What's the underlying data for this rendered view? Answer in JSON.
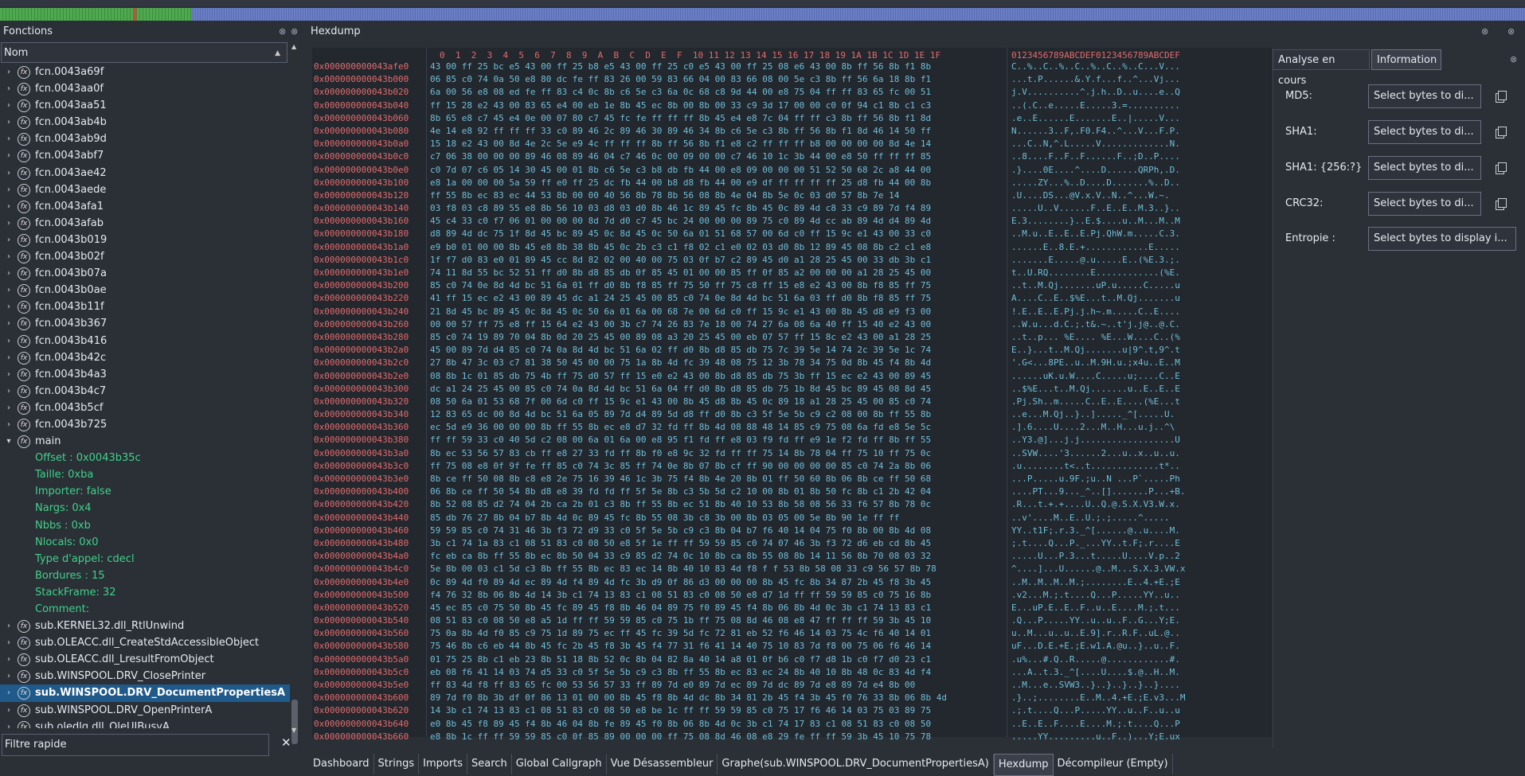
{
  "left_panel": {
    "title": "Fonctions",
    "column_header": "Nom",
    "filter_placeholder": "Filtre rapide",
    "filter_clear": "✕",
    "items": [
      {
        "label": "fcn.0043a69f",
        "kind": "fn"
      },
      {
        "label": "fcn.0043aa0f",
        "kind": "fn"
      },
      {
        "label": "fcn.0043aa51",
        "kind": "fn"
      },
      {
        "label": "fcn.0043ab4b",
        "kind": "fn"
      },
      {
        "label": "fcn.0043ab9d",
        "kind": "fn"
      },
      {
        "label": "fcn.0043abf7",
        "kind": "fn"
      },
      {
        "label": "fcn.0043ae42",
        "kind": "fn"
      },
      {
        "label": "fcn.0043aede",
        "kind": "fn"
      },
      {
        "label": "fcn.0043afa1",
        "kind": "fn"
      },
      {
        "label": "fcn.0043afab",
        "kind": "fn"
      },
      {
        "label": "fcn.0043b019",
        "kind": "fn"
      },
      {
        "label": "fcn.0043b02f",
        "kind": "fn"
      },
      {
        "label": "fcn.0043b07a",
        "kind": "fn"
      },
      {
        "label": "fcn.0043b0ae",
        "kind": "fn"
      },
      {
        "label": "fcn.0043b11f",
        "kind": "fn"
      },
      {
        "label": "fcn.0043b367",
        "kind": "fn"
      },
      {
        "label": "fcn.0043b416",
        "kind": "fn"
      },
      {
        "label": "fcn.0043b42c",
        "kind": "fn"
      },
      {
        "label": "fcn.0043b4a3",
        "kind": "fn"
      },
      {
        "label": "fcn.0043b4c7",
        "kind": "fn"
      },
      {
        "label": "fcn.0043b5cf",
        "kind": "fn"
      },
      {
        "label": "fcn.0043b725",
        "kind": "fn"
      },
      {
        "label": "main",
        "kind": "fn-open"
      },
      {
        "label": "Offset : 0x0043b35c",
        "kind": "prop"
      },
      {
        "label": "Taille: 0xba",
        "kind": "prop"
      },
      {
        "label": "Importer: false",
        "kind": "prop"
      },
      {
        "label": "Nargs: 0x4",
        "kind": "prop"
      },
      {
        "label": "Nbbs : 0xb",
        "kind": "prop"
      },
      {
        "label": "Nlocals: 0x0",
        "kind": "prop"
      },
      {
        "label": "Type d'appel: cdecl",
        "kind": "prop"
      },
      {
        "label": "Bordures : 15",
        "kind": "prop"
      },
      {
        "label": "StackFrame: 32",
        "kind": "prop"
      },
      {
        "label": "Comment:",
        "kind": "prop"
      },
      {
        "label": "sub.KERNEL32.dll_RtlUnwind",
        "kind": "fn"
      },
      {
        "label": "sub.OLEACC.dll_CreateStdAccessibleObject",
        "kind": "fn"
      },
      {
        "label": "sub.OLEACC.dll_LresultFromObject",
        "kind": "fn"
      },
      {
        "label": "sub.WINSPOOL.DRV_ClosePrinter",
        "kind": "fn"
      },
      {
        "label": "sub.WINSPOOL.DRV_DocumentPropertiesA",
        "kind": "fn-selected"
      },
      {
        "label": "sub.WINSPOOL.DRV_OpenPrinterA",
        "kind": "fn"
      },
      {
        "label": "sub.oledlg.dll_OleUIBusyA",
        "kind": "fn"
      }
    ]
  },
  "hexdump": {
    "title": "Hexdump",
    "header_bytes": "0  1  2  3  4  5  6  7  8  9  A  B  C  D  E  F  10 11 12 13 14 15 16 17 18 19 1A 1B 1C 1D 1E 1F",
    "header_ascii": "0123456789ABCDEF0123456789ABCDEF",
    "rows": [
      {
        "addr": "0x000000000043afe0",
        "bytes": "43 00 ff 25 bc e5 43 00 ff 25 b8 e5 43 00 ff 25 c0 e5 43 00 ff 25 08 e6 43 00 8b ff 56 8b f1 8b",
        "ascii": "C..%..C..%..C..%..C..%..C...V..."
      },
      {
        "addr": "0x000000000043b000",
        "bytes": "06 85 c0 74 0a 50 e8 80 dc fe ff 83 26 00 59 83 66 04 00 83 66 08 00 5e c3 8b ff 56 6a 18 8b f1",
        "ascii": "...t.P......&.Y.f...f..^...Vj..."
      },
      {
        "addr": "0x000000000043b020",
        "bytes": "6a 00 56 e8 08 ed fe ff 83 c4 0c 8b c6 5e c3 6a 0c 68 c8 9d 44 00 e8 75 04 ff ff 83 65 fc 00 51",
        "ascii": "j.V..........^.j.h..D..u....e..Q"
      },
      {
        "addr": "0x000000000043b040",
        "bytes": "ff 15 28 e2 43 00 83 65 e4 00 eb 1e 8b 45 ec 8b 00 8b 00 33 c9 3d 17 00 00 c0 0f 94 c1 8b c1 c3",
        "ascii": "..(.C..e.....E.....3.=.........."
      },
      {
        "addr": "0x000000000043b060",
        "bytes": "8b 65 e8 c7 45 e4 0e 00 07 80 c7 45 fc fe ff ff ff 8b 45 e4 e8 7c 04 ff ff c3 8b ff 56 8b f1 8d",
        "ascii": ".e..E......E.......E..|.....V..."
      },
      {
        "addr": "0x000000000043b080",
        "bytes": "4e 14 e8 92 ff ff ff 33 c0 89 46 2c 89 46 30 89 46 34 8b c6 5e c3 8b ff 56 8b f1 8d 46 14 50 ff",
        "ascii": "N......3..F,.F0.F4..^...V...F.P."
      },
      {
        "addr": "0x000000000043b0a0",
        "bytes": "15 18 e2 43 00 8d 4e 2c 5e e9 4c ff ff ff 8b ff 56 8b f1 e8 c2 ff ff ff b8 00 00 00 00 8d 4e 14",
        "ascii": "...C..N,^.L.....V.............N."
      },
      {
        "addr": "0x000000000043b0c0",
        "bytes": "c7 06 38 00 00 00 89 46 08 89 46 04 c7 46 0c 00 09 00 00 c7 46 10 1c 3b 44 00 e8 50 ff ff ff 85",
        "ascii": "..8....F..F..F......F..;D..P...."
      },
      {
        "addr": "0x000000000043b0e0",
        "bytes": "c0 7d 07 c6 05 14 30 45 00 01 8b c6 5e c3 b8 db fb 44 00 e8 09 00 00 00 51 52 50 68 2c a8 44 00",
        "ascii": ".}....0E....^....D......QRPh,.D."
      },
      {
        "addr": "0x000000000043b100",
        "bytes": "e8 1a 00 00 00 5a 59 ff e0 ff 25 dc fb 44 00 b8 d8 fb 44 00 e9 df ff ff ff ff 25 d8 fb 44 00 8b",
        "ascii": ".....ZY...%..D....D.......%..D.."
      },
      {
        "addr": "0x000000000043b120",
        "bytes": "ff 55 8b ec 83 ec 44 53 8b 00 00 40 56 8b 78 8b 56 08 8b 4e 04 8b 5e 0c 03 d0 57 8b 7e 14",
        "ascii": ".U....DS...@V.x.V..N..^...W.~."
      },
      {
        "addr": "0x000000000043b140",
        "bytes": "03 f8 03 c8 89 55 e8 8b 56 10 03 d8 03 d0 8b 46 1c 89 45 fc 8b 45 0c 89 4d c8 33 c9 89 7d f4 89",
        "ascii": ".....U..V......F..E..E..M.3..}.."
      },
      {
        "addr": "0x000000000043b160",
        "bytes": "45 c4 33 c0 f7 06 01 00 00 00 8d 7d d0 c7 45 bc 24 00 00 00 89 75 c0 89 4d cc ab 89 4d d4 89 4d",
        "ascii": "E.3........}..E.$....u..M...M..M"
      },
      {
        "addr": "0x000000000043b180",
        "bytes": "d8 89 4d dc 75 1f 8d 45 bc 89 45 0c 8d 45 0c 50 6a 01 51 68 57 00 6d c0 ff 15 9c e1 43 00 33 c0",
        "ascii": "..M.u..E..E..E.Pj.QhW.m.....C.3."
      },
      {
        "addr": "0x000000000043b1a0",
        "bytes": "e9 b0 01 00 00 8b 45 e8 8b 38 8b 45 0c 2b c3 c1 f8 02 c1 e0 02 03 d0 8b 12 89 45 08 8b c2 c1 e8",
        "ascii": "......E..8.E.+............E....."
      },
      {
        "addr": "0x000000000043b1c0",
        "bytes": "1f f7 d0 83 e0 01 89 45 cc 8d 82 02 00 40 00 75 03 0f b7 c2 89 45 d0 a1 28 25 45 00 33 db 3b c1",
        "ascii": ".......E.....@.u.....E..(%E.3.;."
      },
      {
        "addr": "0x000000000043b1e0",
        "bytes": "74 11 8d 55 bc 52 51 ff d0 8b d8 85 db 0f 85 45 01 00 00 85 ff 0f 85 a2 00 00 00 a1 28 25 45 00",
        "ascii": "t..U.RQ........E............(%E."
      },
      {
        "addr": "0x000000000043b200",
        "bytes": "85 c0 74 0e 8d 4d bc 51 6a 01 ff d0 8b f8 85 ff 75 50 ff 75 c8 ff 15 e8 e2 43 00 8b f8 85 ff 75",
        "ascii": "..t..M.Qj.......uP.u.....C.....u"
      },
      {
        "addr": "0x000000000043b220",
        "bytes": "41 ff 15 ec e2 43 00 89 45 dc a1 24 25 45 00 85 c0 74 0e 8d 4d bc 51 6a 03 ff d0 8b f8 85 ff 75",
        "ascii": "A....C..E..$%E...t..M.Qj.......u"
      },
      {
        "addr": "0x000000000043b240",
        "bytes": "21 8d 45 bc 89 45 0c 8d 45 0c 50 6a 01 6a 00 68 7e 00 6d c0 ff 15 9c e1 43 00 8b 45 d8 e9 f3 00",
        "ascii": "!.E..E..E.Pj.j.h~.m.....C..E...."
      },
      {
        "addr": "0x000000000043b260",
        "bytes": "00 00 57 ff 75 e8 ff 15 64 e2 43 00 3b c7 74 26 83 7e 18 00 74 27 6a 08 6a 40 ff 15 40 e2 43 00",
        "ascii": "..W.u...d.C.;.t&.~..t'j.j@..@.C."
      },
      {
        "addr": "0x000000000043b280",
        "bytes": "85 c0 74 19 89 70 04 8b 0d 20 25 45 00 89 08 a3 20 25 45 00 eb 07 57 ff 15 8c e2 43 00 a1 28 25",
        "ascii": "..t..p... %E.... %E...W....C..(%"
      },
      {
        "addr": "0x000000000043b2a0",
        "bytes": "45 00 89 7d d4 85 c0 74 0a 8d 4d bc 51 6a 02 ff d0 8b d8 85 db 75 7c 39 5e 14 74 2c 39 5e 1c 74",
        "ascii": "E..}...t..M.Qj.......u|9^.t,9^.t"
      },
      {
        "addr": "0x000000000043b2c0",
        "bytes": "27 8b 47 3c 03 c7 81 38 50 45 00 00 75 1a 8b 4d fc 39 48 08 75 12 3b 78 34 75 0d 8b 45 f4 8b 4d",
        "ascii": "'.G<...8PE..u..M.9H.u.;x4u..E..M"
      },
      {
        "addr": "0x000000000043b2e0",
        "bytes": "08 8b 1c 01 85 db 75 4b ff 75 d0 57 ff 15 e0 e2 43 00 8b d8 85 db 75 3b ff 15 ec e2 43 00 89 45",
        "ascii": "......uK.u.W....C.....u;....C..E"
      },
      {
        "addr": "0x000000000043b300",
        "bytes": "dc a1 24 25 45 00 85 c0 74 0a 8d 4d bc 51 6a 04 ff d0 8b d8 85 db 75 1b 8d 45 bc 89 45 08 8d 45",
        "ascii": "..$%E...t..M.Qj.......u..E..E..E"
      },
      {
        "addr": "0x000000000043b320",
        "bytes": "08 50 6a 01 53 68 7f 00 6d c0 ff 15 9c e1 43 00 8b 45 d8 8b 45 0c 89 18 a1 28 25 45 00 85 c0 74",
        "ascii": ".Pj.Sh..m.....C..E..E....(%E...t"
      },
      {
        "addr": "0x000000000043b340",
        "bytes": "12 83 65 dc 00 8d 4d bc 51 6a 05 89 7d d4 89 5d d8 ff d0 8b c3 5f 5e 5b c9 c2 08 00 8b ff 55 8b",
        "ascii": "..e...M.Qj..}..]....._^[.....U."
      },
      {
        "addr": "0x000000000043b360",
        "bytes": "ec 5d e9 36 00 00 00 8b ff 55 8b ec e8 d7 32 fd ff 8b 4d 08 88 48 14 85 c9 75 08 6a fd e8 5e 5c",
        "ascii": ".].6....U....2...M..H...u.j..^\\"
      },
      {
        "addr": "0x000000000043b380",
        "bytes": "ff ff 59 33 c0 40 5d c2 08 00 6a 01 6a 00 e8 95 f1 fd ff e8 03 f9 fd ff e9 1e f2 fd ff 8b ff 55",
        "ascii": "..Y3.@]...j.j..................U"
      },
      {
        "addr": "0x000000000043b3a0",
        "bytes": "8b ec 53 56 57 83 cb ff e8 27 33 fd ff 8b f0 e8 9c 32 fd ff ff 75 14 8b 78 04 ff 75 10 ff 75 0c",
        "ascii": "..SVW....'3......2...u..x..u..u."
      },
      {
        "addr": "0x000000000043b3c0",
        "bytes": "ff 75 08 e8 0f 9f fe ff 85 c0 74 3c 85 ff 74 0e 8b 07 8b cf ff 90 00 00 00 00 85 c0 74 2a 8b 06",
        "ascii": ".u........t<..t.............t*.."
      },
      {
        "addr": "0x000000000043b3e0",
        "bytes": "8b ce ff 50 08 8b c8 e8 2e 75 16 39 46 1c 3b 75 f4 8b 4e 20 8b 01 ff 50 60 8b 06 8b ce ff 50 68",
        "ascii": "...P.....u.9F.;u..N ...P`.....Ph"
      },
      {
        "addr": "0x000000000043b400",
        "bytes": "06 8b ce ff 50 54 8b d8 e8 39 fd fd ff 5f 5e 8b c3 5b 5d c2 10 00 8b 01 8b 50 fc 8b c1 2b 42 04",
        "ascii": "....PT...9..._^..[].......P...+B."
      },
      {
        "addr": "0x000000000043b420",
        "bytes": "8b 52 08 85 d2 74 04 2b ca 2b 01 c3 8b ff 55 8b ec 51 8b 40 10 53 8b 58 08 56 33 f6 57 8b 78 0c",
        "ascii": ".R...t.+.+....U..Q.@.S.X.V3.W.x."
      },
      {
        "addr": "0x000000000043b440",
        "bytes": "85 db 76 27 8b 04 b7 8b 4d 0c 89 45 fc 8b 55 08 3b c8 3b 00 8b 03 05 00 5e 8b 90 1e ff ff",
        "ascii": "..v'....M..E..U.;.;.....^....."
      },
      {
        "addr": "0x000000000043b460",
        "bytes": "59 59 85 c0 74 31 46 3b f3 72 d9 33 c0 5f 5e 5b c9 c3 8b 04 b7 f6 40 14 04 75 f0 8b 00 8b 4d 08",
        "ascii": "YY..t1F;.r.3._^[......@..u....M."
      },
      {
        "addr": "0x000000000043b480",
        "bytes": "3b c1 74 1a 83 c1 08 51 83 c0 08 50 e8 5f 1e ff ff 59 59 85 c0 74 07 46 3b f3 72 d6 eb cd 8b 45",
        "ascii": ";.t....Q...P._...YY..t.F;.r....E"
      },
      {
        "addr": "0x000000000043b4a0",
        "bytes": "fc eb ca 8b ff 55 8b ec 8b 50 04 33 c9 85 d2 74 0c 10 8b ca 8b 55 08 8b 14 11 56 8b 70 08 03 32",
        "ascii": ".....U...P.3...t.....U....V.p..2"
      },
      {
        "addr": "0x000000000043b4c0",
        "bytes": "5e 8b 00 03 c1 5d c3 8b ff 55 8b ec 83 ec 14 8b 40 10 83 4d f8 f f 53 8b 58 08 33 c9 56 57 8b 78",
        "ascii": "^....]...U......@..M...S.X.3.VW.x"
      },
      {
        "addr": "0x000000000043b4e0",
        "bytes": "0c 89 4d f0 89 4d ec 89 4d f4 89 4d fc 3b d9 0f 86 d3 00 00 00 8b 45 fc 8b 34 87 2b 45 f8 3b 45",
        "ascii": "..M..M..M..M.;........E..4.+E.;E"
      },
      {
        "addr": "0x000000000043b500",
        "bytes": "f4 76 32 8b 06 8b 4d 14 3b c1 74 13 83 c1 08 51 83 c0 08 50 e8 d7 1d ff ff 59 59 85 c0 75 16 8b",
        "ascii": ".v2...M.;.t....Q...P.....YY..u.."
      },
      {
        "addr": "0x000000000043b520",
        "bytes": "45 ec 85 c0 75 50 8b 45 fc 89 45 f8 8b 46 04 89 75 f0 89 45 f4 8b 06 8b 4d 0c 3b c1 74 13 83 c1",
        "ascii": "E...uP.E..E..F..u..E....M.;.t..."
      },
      {
        "addr": "0x000000000043b540",
        "bytes": "08 51 83 c0 08 50 e8 a5 1d ff ff 59 59 85 c0 75 1b ff 75 08 8d 46 08 e8 47 ff ff ff 59 3b 45 10",
        "ascii": ".Q...P.....YY..u..u..F..G...Y;E."
      },
      {
        "addr": "0x000000000043b560",
        "bytes": "75 0a 8b 4d f0 85 c9 75 1d 89 75 ec ff 45 fc 39 5d fc 72 81 eb 52 f6 46 14 03 75 4c f6 40 14 01",
        "ascii": "u..M...u..u..E.9].r..R.F..uL.@.."
      },
      {
        "addr": "0x000000000043b580",
        "bytes": "75 46 8b c6 eb 44 8b 45 fc 2b 45 f8 3b 45 f4 77 31 f6 41 14 40 75 10 83 7d f8 00 75 06 f6 46 14",
        "ascii": "uF...D.E.+E.;E.w1.A.@u..}..u..F."
      },
      {
        "addr": "0x000000000043b5a0",
        "bytes": "01 75 25 8b c1 eb 23 8b 51 18 8b 52 0c 8b 04 82 8a 40 14 a8 01 0f b6 c0 f7 d8 1b c0 f7 d0 23 c1",
        "ascii": ".u%...#.Q..R.....@............#."
      },
      {
        "addr": "0x000000000043b5c0",
        "bytes": "eb 08 f6 41 14 03 74 d5 33 c0 5f 5e 5b c9 c3 8b ff 55 8b ec 83 ec 24 8b 40 10 8b 48 0c 83 4d f4",
        "ascii": "...A..t.3._^[....U....$.@..H..M."
      },
      {
        "addr": "0x000000000043b5e0",
        "bytes": "ff 83 4d f8 ff 83 65 fc 00 53 56 57 33 ff 89 7d e0 89 7d ec 89 7d dc 89 7d e8 89 7d e4 8b 00",
        "ascii": "..M...e..SVW3..}..}..}..}..}...."
      },
      {
        "addr": "0x000000000043b600",
        "bytes": "89 7d f0 8b 3b df 0f 86 13 01 00 00 8b 45 f8 8b 4d dc 8b 34 81 2b 45 f4 3b 45 f0 76 33 8b 06 8b 4d",
        "ascii": ".}..;........E..M..4.+E.;E.v3...M"
      },
      {
        "addr": "0x000000000043b620",
        "bytes": "14 3b c1 74 13 83 c1 08 51 83 c0 08 50 e8 be 1c ff ff 59 59 85 c0 75 17 f6 46 14 03 75 03 89 75",
        "ascii": ".;.t....Q...P.....YY..u..F..u..u"
      },
      {
        "addr": "0x000000000043b640",
        "bytes": "e0 8b 45 f8 89 45 f4 8b 46 04 8b fe 89 45 f0 8b 06 8b 4d 0c 3b c1 74 17 83 c1 08 51 83 c0 08 50",
        "ascii": "..E..E..F....E....M.;.t....Q...P"
      },
      {
        "addr": "0x000000000043b660",
        "bytes": "e8 8b 1c ff ff 59 59 85 c0 0f 85 89 00 00 00 ff 75 08 8d 46 08 e8 29 fe ff ff 59 3b 45 10 75 78",
        "ascii": ".....YY.........u..F..)...Y;E.ux"
      }
    ]
  },
  "right_panel": {
    "tabs": [
      "Analyse en cours",
      "Information"
    ],
    "active_tab": "Information",
    "hash_rows": [
      {
        "label": "MD5:",
        "button": "Select bytes to di...",
        "has_copy": true
      },
      {
        "label": "SHA1:",
        "button": "Select bytes to di...",
        "has_copy": true
      },
      {
        "label": "SHA1: {256:?}",
        "button": "Select bytes to di...",
        "has_copy": true
      },
      {
        "label": "CRC32:",
        "button": "Select bytes to di...",
        "has_copy": true
      },
      {
        "label": "Entropie :",
        "button": "Select bytes to display i...",
        "has_copy": false
      }
    ]
  },
  "bottom_tabs": [
    "Dashboard",
    "Strings",
    "Imports",
    "Search",
    "Global Callgraph",
    "Vue Désassembleur",
    "Graphe(sub.WINSPOOL.DRV_DocumentPropertiesA)",
    "Hexdump",
    "Décompileur (Empty)"
  ],
  "active_bottom_tab": "Hexdump"
}
